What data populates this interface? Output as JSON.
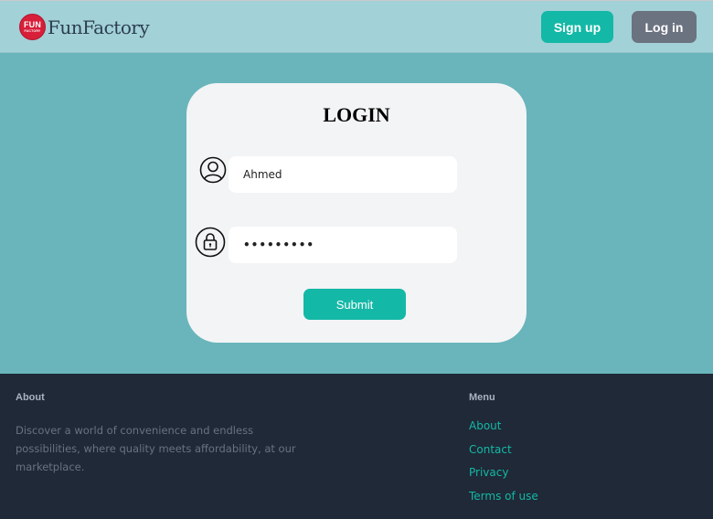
{
  "header": {
    "logo_line1": "FUN",
    "logo_line2": "FACTORY",
    "brand_name": "FunFactory",
    "signup_label": "Sign up",
    "login_label": "Log in"
  },
  "login": {
    "title": "LOGIN",
    "username_value": "Ahmed",
    "password_value": "•••••••••",
    "submit_label": "Submit"
  },
  "footer": {
    "about_heading": "About",
    "about_text": "Discover a world of convenience and endless possibilities, where quality meets affordability, at our marketplace.",
    "menu_heading": "Menu",
    "menu_items": [
      "About",
      "Contact",
      "Privacy",
      "Terms of use"
    ]
  },
  "colors": {
    "header_bg": "#a2d1d7",
    "page_bg": "#69b5bb",
    "accent": "#14b8a6",
    "secondary_button": "#6b7280",
    "footer_bg": "#1f2937",
    "logo_red": "#d71f3a"
  },
  "icons": {
    "username": "user-circle-icon",
    "password": "lock-circle-icon"
  }
}
